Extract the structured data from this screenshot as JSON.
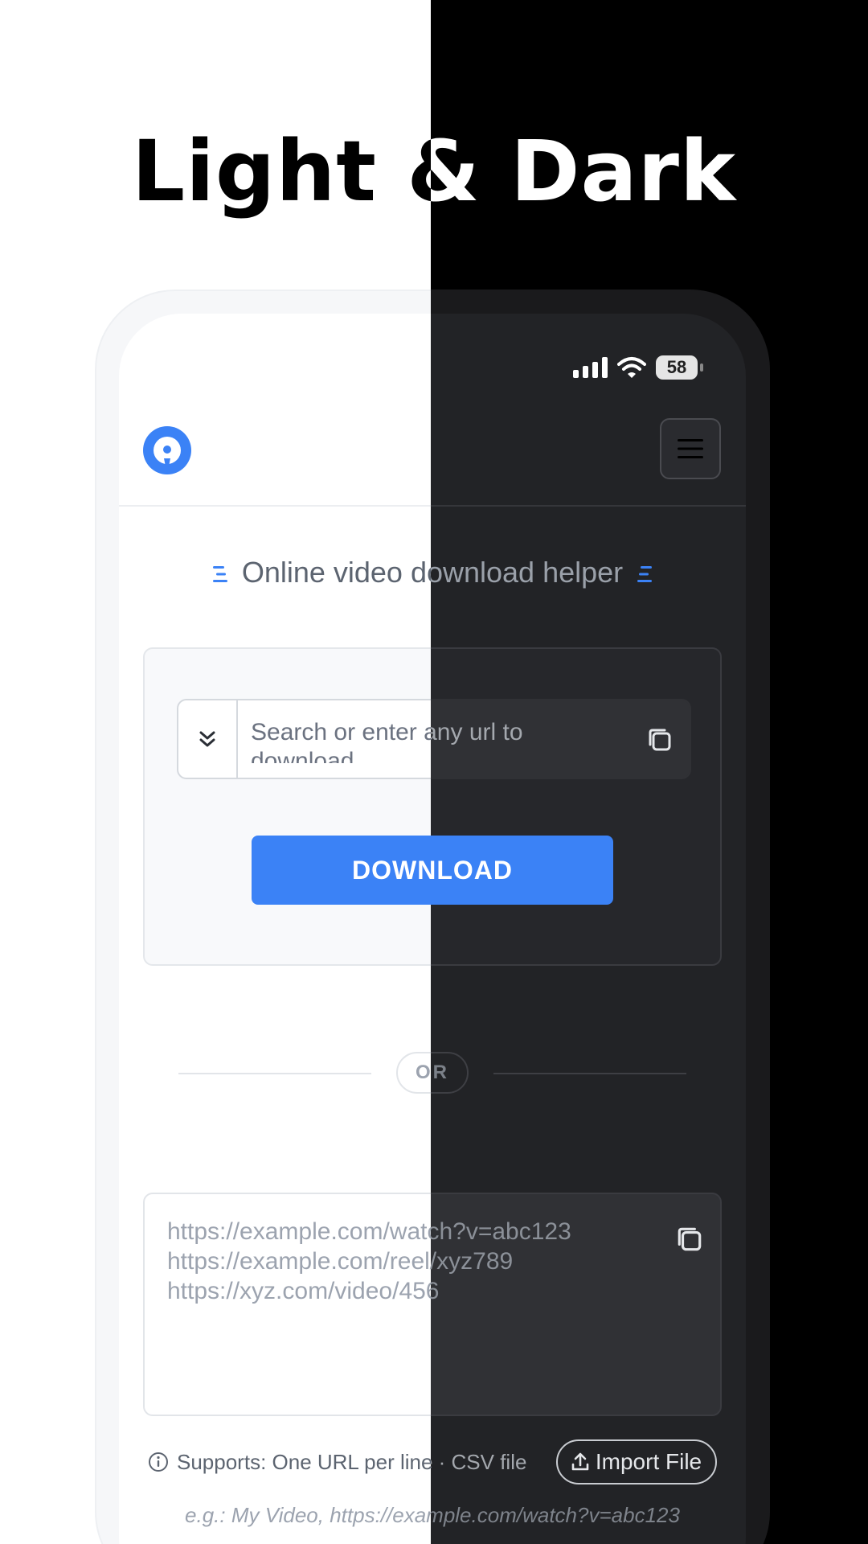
{
  "headline": "Light & Dark",
  "status_bar": {
    "battery": "58"
  },
  "app": {
    "helper_title": "Online video download helper",
    "search": {
      "placeholder": "Search or enter any url to download"
    },
    "download_label": "DOWNLOAD",
    "divider_label": "OR",
    "url_examples": [
      "https://example.com/watch?v=abc123",
      "https://example.com/reel/xyz789",
      "https://xyz.com/video/456"
    ],
    "support_text": "Supports: One URL per line · CSV file",
    "import_label": "Import File",
    "example_text": "e.g.: My Video, https://example.com/watch?v=abc123"
  },
  "colors": {
    "accent": "#3b82f6",
    "light_bg": "#ffffff",
    "dark_bg": "#000000",
    "dark_screen": "#222326"
  }
}
